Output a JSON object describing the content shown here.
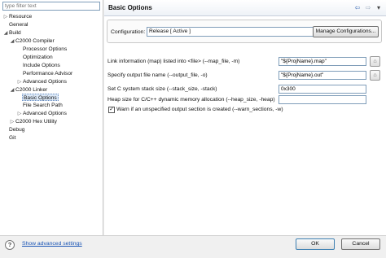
{
  "filter": {
    "placeholder": "type filter text"
  },
  "tree": [
    {
      "label": "Resource",
      "toggle": "▷"
    },
    {
      "label": "General",
      "toggle": ""
    },
    {
      "label": "Build",
      "toggle": "◢"
    },
    {
      "label": "C2000 Compiler",
      "toggle": "◢"
    },
    {
      "label": "Processor Options",
      "toggle": ""
    },
    {
      "label": "Optimization",
      "toggle": ""
    },
    {
      "label": "Include Options",
      "toggle": ""
    },
    {
      "label": "Performance Advisor",
      "toggle": ""
    },
    {
      "label": "Advanced Options",
      "toggle": "▷"
    },
    {
      "label": "C2000 Linker",
      "toggle": "◢"
    },
    {
      "label": "Basic Options",
      "toggle": ""
    },
    {
      "label": "File Search Path",
      "toggle": ""
    },
    {
      "label": "Advanced Options",
      "toggle": "▷"
    },
    {
      "label": "C2000 Hex Utility",
      "toggle": "▷"
    },
    {
      "label": "Debug",
      "toggle": ""
    },
    {
      "label": "Git",
      "toggle": ""
    }
  ],
  "panel": {
    "title": "Basic Options",
    "nav_back": "⇦",
    "nav_forward": "⇨",
    "nav_menu": "▾",
    "configuration_label": "Configuration:",
    "configuration_value": "Release  [ Active ]",
    "manage_button": "Manage Configurations...",
    "fields": [
      {
        "label": "Link information (map) listed into <file> (--map_file, -m)",
        "value": "\"${ProjName}.map\""
      },
      {
        "label": "Specify output file name (--output_file, -o)",
        "value": "\"${ProjName}.out\""
      },
      {
        "label": "Set C system stack size (--stack_size, -stack)",
        "value": "0x300"
      },
      {
        "label": "Heap size for C/C++ dynamic memory allocation (--heap_size, -heap)",
        "value": ""
      }
    ],
    "warn_label": "Warn if an unspecified output section is created (--warn_sections, -w)",
    "warn_checked": true
  },
  "bottom": {
    "help": "?",
    "advanced_link": "Show advanced settings",
    "ok": "OK",
    "cancel": "Cancel"
  }
}
